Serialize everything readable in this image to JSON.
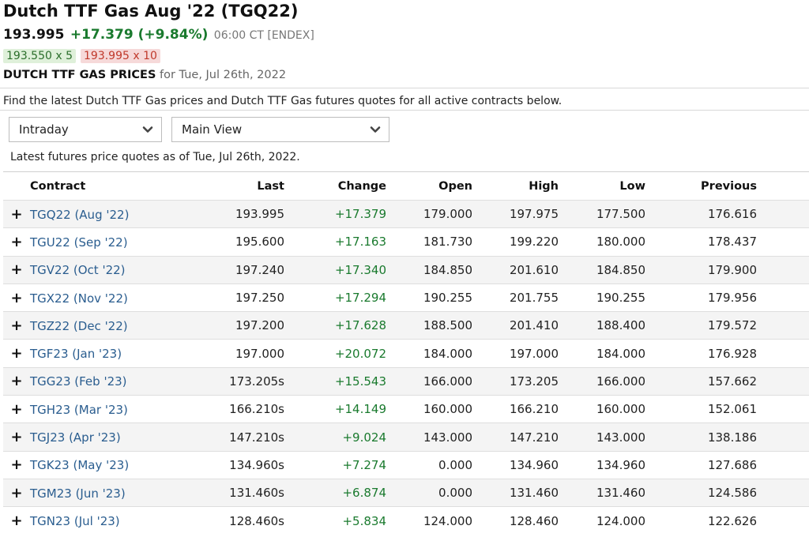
{
  "header": {
    "title": "Dutch TTF Gas Aug '22 (TGQ22)",
    "last": "193.995",
    "change": "+17.379 (+9.84%)",
    "time": "06:00 CT [ENDEX]",
    "bid": "193.550 x 5",
    "ask": "193.995 x 10",
    "prices_heading": "DUTCH TTF GAS PRICES",
    "prices_date": "for Tue, Jul 26th, 2022"
  },
  "description": "Find the latest Dutch TTF Gas prices and Dutch TTF Gas futures quotes for all active contracts below.",
  "controls": {
    "period_select": "Intraday",
    "view_select": "Main View"
  },
  "as_of": "Latest futures price quotes as of Tue, Jul 26th, 2022.",
  "colors": {
    "positive": "#1a7a2e",
    "negative": "#c0392b",
    "link": "#2a5d8f"
  },
  "table": {
    "headers": {
      "contract": "Contract",
      "last": "Last",
      "change": "Change",
      "open": "Open",
      "high": "High",
      "low": "Low",
      "previous": "Previous"
    },
    "expand_icon": "+",
    "rows": [
      {
        "contract": "TGQ22 (Aug '22)",
        "last": "193.995",
        "change": "+17.379",
        "open": "179.000",
        "high": "197.975",
        "low": "177.500",
        "previous": "176.616"
      },
      {
        "contract": "TGU22 (Sep '22)",
        "last": "195.600",
        "change": "+17.163",
        "open": "181.730",
        "high": "199.220",
        "low": "180.000",
        "previous": "178.437"
      },
      {
        "contract": "TGV22 (Oct '22)",
        "last": "197.240",
        "change": "+17.340",
        "open": "184.850",
        "high": "201.610",
        "low": "184.850",
        "previous": "179.900"
      },
      {
        "contract": "TGX22 (Nov '22)",
        "last": "197.250",
        "change": "+17.294",
        "open": "190.255",
        "high": "201.755",
        "low": "190.255",
        "previous": "179.956"
      },
      {
        "contract": "TGZ22 (Dec '22)",
        "last": "197.200",
        "change": "+17.628",
        "open": "188.500",
        "high": "201.410",
        "low": "188.400",
        "previous": "179.572"
      },
      {
        "contract": "TGF23 (Jan '23)",
        "last": "197.000",
        "change": "+20.072",
        "open": "184.000",
        "high": "197.000",
        "low": "184.000",
        "previous": "176.928"
      },
      {
        "contract": "TGG23 (Feb '23)",
        "last": "173.205s",
        "change": "+15.543",
        "open": "166.000",
        "high": "173.205",
        "low": "166.000",
        "previous": "157.662"
      },
      {
        "contract": "TGH23 (Mar '23)",
        "last": "166.210s",
        "change": "+14.149",
        "open": "160.000",
        "high": "166.210",
        "low": "160.000",
        "previous": "152.061"
      },
      {
        "contract": "TGJ23 (Apr '23)",
        "last": "147.210s",
        "change": "+9.024",
        "open": "143.000",
        "high": "147.210",
        "low": "143.000",
        "previous": "138.186"
      },
      {
        "contract": "TGK23 (May '23)",
        "last": "134.960s",
        "change": "+7.274",
        "open": "0.000",
        "high": "134.960",
        "low": "134.960",
        "previous": "127.686"
      },
      {
        "contract": "TGM23 (Jun '23)",
        "last": "131.460s",
        "change": "+6.874",
        "open": "0.000",
        "high": "131.460",
        "low": "131.460",
        "previous": "124.586"
      },
      {
        "contract": "TGN23 (Jul '23)",
        "last": "128.460s",
        "change": "+5.834",
        "open": "124.000",
        "high": "128.460",
        "low": "124.000",
        "previous": "122.626"
      }
    ]
  }
}
